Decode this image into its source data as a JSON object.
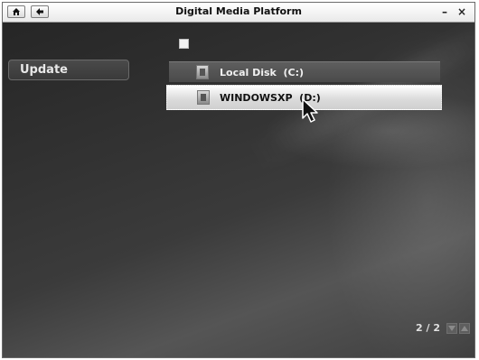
{
  "window": {
    "title": "Digital Media Platform",
    "minimize_glyph": "–",
    "close_glyph": "×"
  },
  "toolbar": {
    "home_icon": "home-icon",
    "back_icon": "back-arrow-icon"
  },
  "sidebar": {
    "update_label": "Update"
  },
  "select_all": {
    "checked": false
  },
  "drives": [
    {
      "label": "Local Disk  (C:)",
      "selected": false,
      "icon": "drive-icon"
    },
    {
      "label": "WINDOWSXP  (D:)",
      "selected": true,
      "icon": "drive-icon"
    }
  ],
  "pager": {
    "text": "2 / 2",
    "prev_icon": "chevron-down-icon",
    "next_icon": "chevron-up-icon"
  }
}
